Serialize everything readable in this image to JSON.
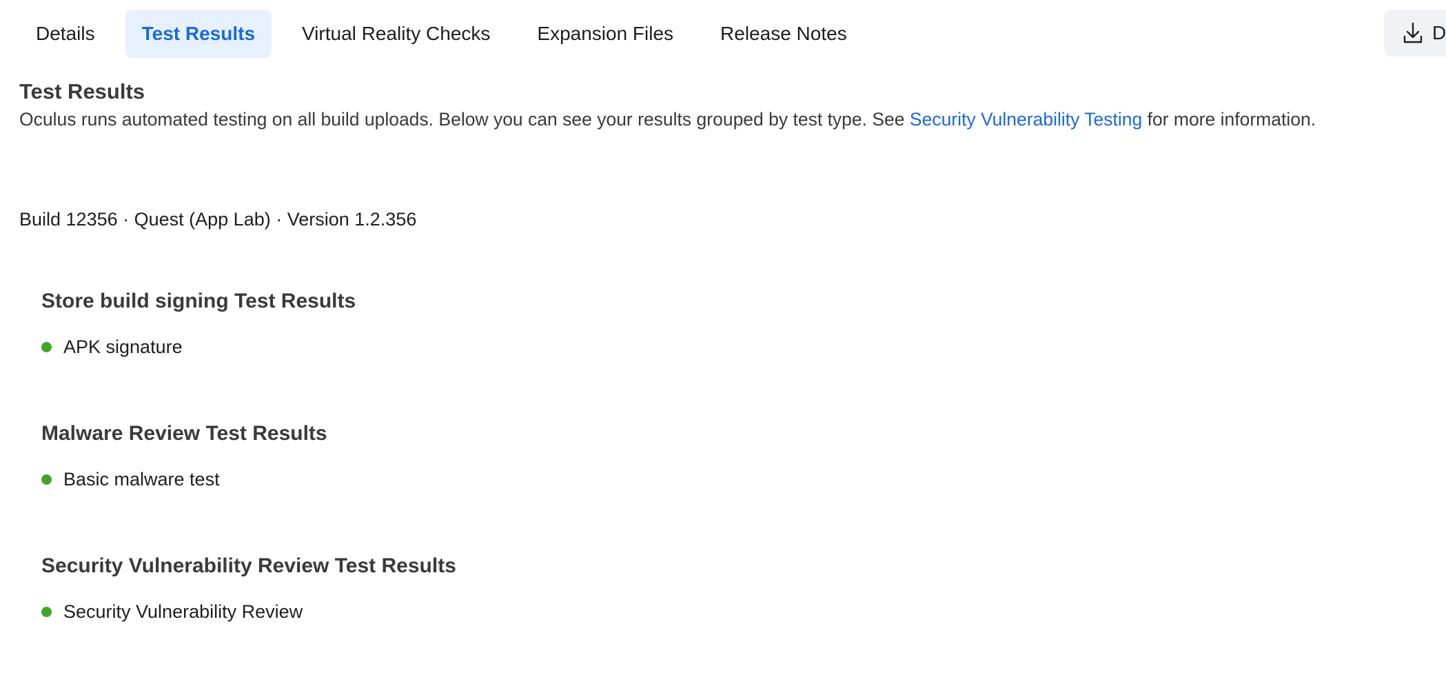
{
  "tabs": [
    {
      "label": "Details",
      "active": false
    },
    {
      "label": "Test Results",
      "active": true
    },
    {
      "label": "Virtual Reality Checks",
      "active": false
    },
    {
      "label": "Expansion Files",
      "active": false
    },
    {
      "label": "Release Notes",
      "active": false
    }
  ],
  "download_button": {
    "label": "D",
    "icon": "download-icon"
  },
  "header": {
    "title": "Test Results",
    "description_before": "Oculus runs automated testing on all build uploads. Below you can see your results grouped by test type. See ",
    "description_link": "Security Vulnerability Testing",
    "description_after": " for more information."
  },
  "build_info": "Build 12356 · Quest (App Lab) · Version 1.2.356",
  "sections": [
    {
      "title": "Store build signing Test Results",
      "result": "APK signature",
      "status": "pass"
    },
    {
      "title": "Malware Review Test Results",
      "result": "Basic malware test",
      "status": "pass"
    },
    {
      "title": "Security Vulnerability Review Test Results",
      "result": "Security Vulnerability Review",
      "status": "pass"
    }
  ],
  "colors": {
    "accent": "#1b6ad6",
    "active_tab_bg": "#e7f0fd",
    "pass": "#42a62a"
  }
}
